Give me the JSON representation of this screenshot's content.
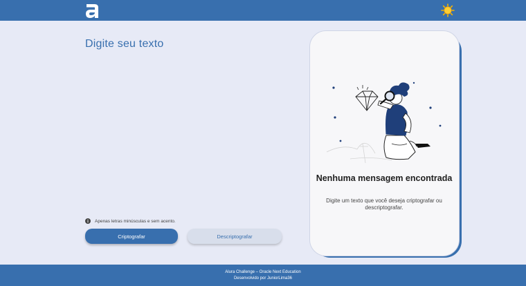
{
  "header": {
    "logo_icon": "alura-logo-icon",
    "theme_icon": "sun-icon"
  },
  "main": {
    "title": "Digite seu texto",
    "hint_icon": "info-icon",
    "hint_text": "Apenas letras minúsculas e sem acento.",
    "encrypt_label": "Criptografar",
    "decrypt_label": "Descriptografar"
  },
  "output": {
    "illustration": "person-with-magnifier-illustration",
    "empty_title": "Nenhuma mensagem encontrada",
    "empty_desc": "Digite um texto que você deseja criptografar ou descriptografar."
  },
  "footer": {
    "line1": "Alura Challenge – Oracle Next Education",
    "line2": "Desenvolvido por JuniorLima36"
  },
  "colors": {
    "brand": "#386fae",
    "background": "#e7eaf6",
    "card": "#f7f7f9",
    "secondary_button": "#d8deeb"
  }
}
